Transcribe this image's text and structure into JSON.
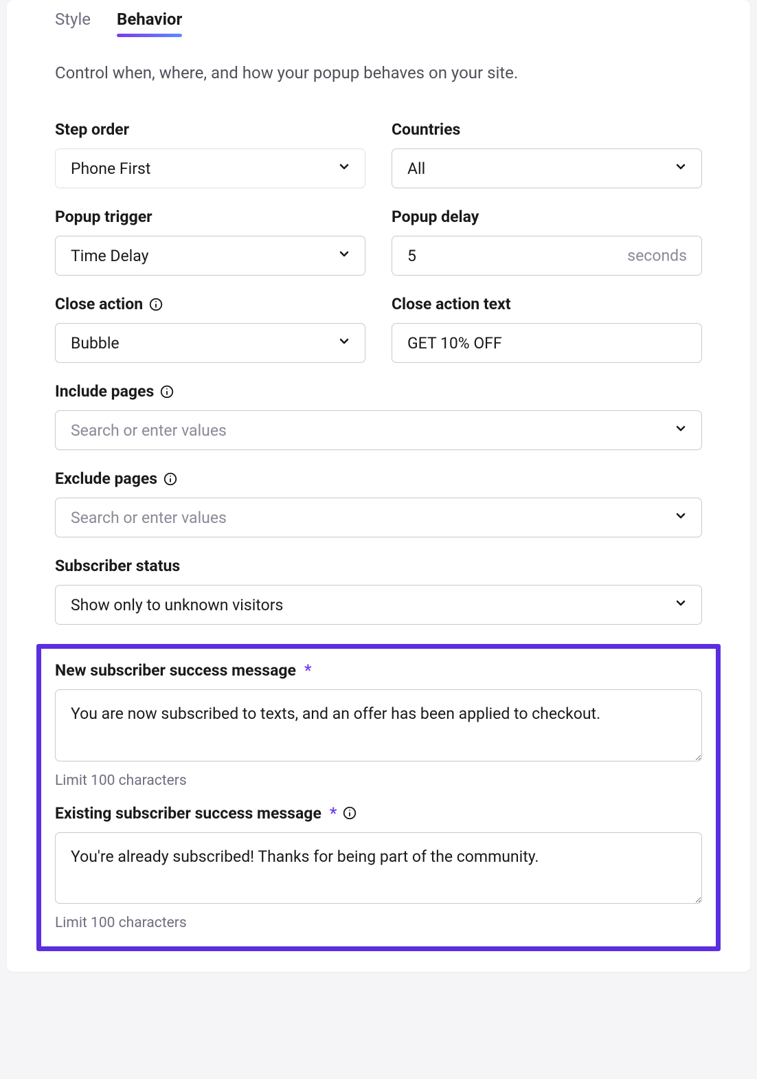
{
  "tabs": {
    "style": "Style",
    "behavior": "Behavior"
  },
  "intro": "Control when, where, and how your popup behaves on your site.",
  "stepOrder": {
    "label": "Step order",
    "value": "Phone First"
  },
  "countries": {
    "label": "Countries",
    "value": "All"
  },
  "popupTrigger": {
    "label": "Popup trigger",
    "value": "Time Delay"
  },
  "popupDelay": {
    "label": "Popup delay",
    "value": "5",
    "suffix": "seconds"
  },
  "closeAction": {
    "label": "Close action",
    "value": "Bubble"
  },
  "closeActionText": {
    "label": "Close action text",
    "value": "GET 10% OFF"
  },
  "includePages": {
    "label": "Include pages",
    "placeholder": "Search or enter values"
  },
  "excludePages": {
    "label": "Exclude pages",
    "placeholder": "Search or enter values"
  },
  "subscriberStatus": {
    "label": "Subscriber status",
    "value": "Show only to unknown visitors"
  },
  "newSubMsg": {
    "label": "New subscriber success message",
    "value": "You are now subscribed to texts, and an offer has been applied to checkout.",
    "helper": "Limit 100 characters"
  },
  "existingSubMsg": {
    "label": "Existing subscriber success message",
    "value": "You're already subscribed! Thanks for being part of the community.",
    "helper": "Limit 100 characters"
  }
}
